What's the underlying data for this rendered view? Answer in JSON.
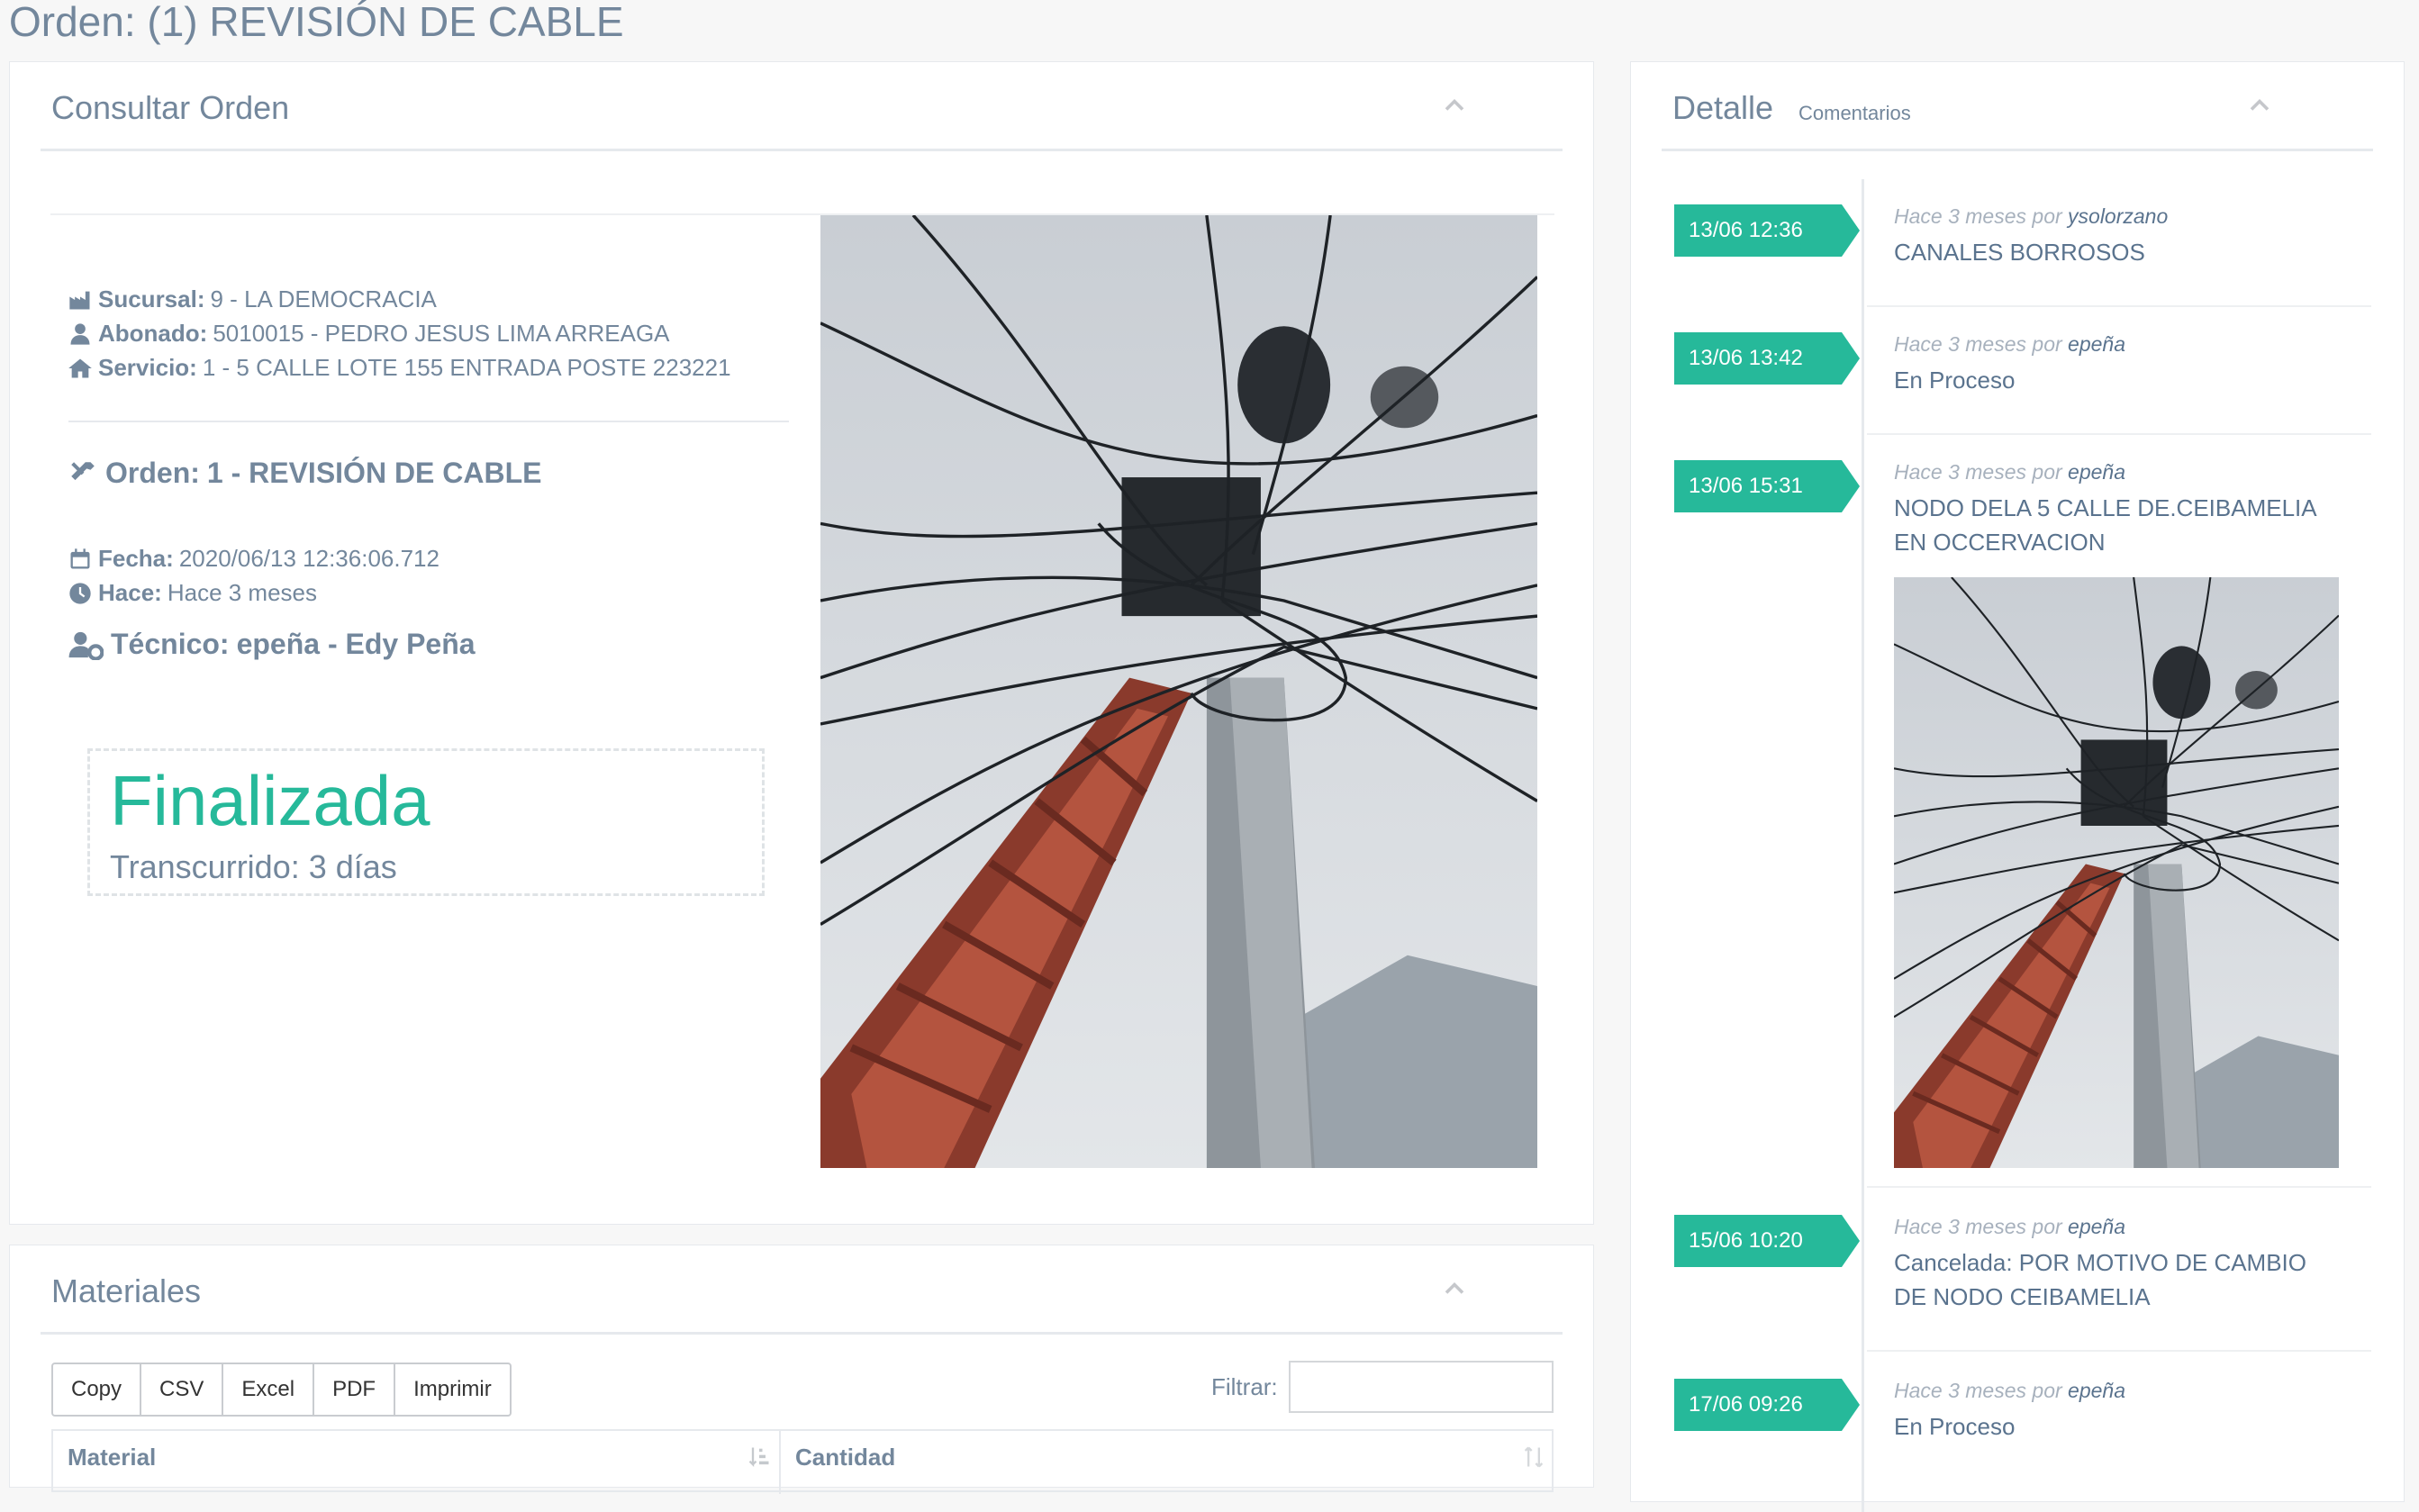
{
  "page": {
    "title": "Orden: (1) REVISIÓN DE CABLE"
  },
  "consultar": {
    "title": "Consultar Orden",
    "sucursal_label": "Sucursal:",
    "sucursal_value": "9 - LA DEMOCRACIA",
    "abonado_label": "Abonado:",
    "abonado_value": "5010015 - PEDRO JESUS LIMA ARREAGA",
    "servicio_label": "Servicio:",
    "servicio_value": "1 - 5 CALLE LOTE 155 ENTRADA POSTE 223221",
    "orden_label": "Orden:",
    "orden_value": "1 - REVISIÓN DE CABLE",
    "fecha_label": "Fecha:",
    "fecha_value": "2020/06/13 12:36:06.712",
    "hace_label": "Hace:",
    "hace_value": "Hace 3 meses",
    "tecnico_label": "Técnico:",
    "tecnico_value": "epeña - Edy Peña",
    "status": "Finalizada",
    "elapsed": "Transcurrido: 3 días"
  },
  "materiales": {
    "title": "Materiales",
    "buttons": [
      "Copy",
      "CSV",
      "Excel",
      "PDF",
      "Imprimir"
    ],
    "filter_label": "Filtrar:",
    "filter_value": "",
    "columns": [
      "Material",
      "Cantidad"
    ]
  },
  "detalle": {
    "title": "Detalle",
    "subtitle": "Comentarios",
    "meta_prefix": "Hace 3 meses por",
    "entries": [
      {
        "time": "13/06 12:36",
        "user": "ysolorzano",
        "text": "CANALES BORROSOS"
      },
      {
        "time": "13/06 13:42",
        "user": "epeña",
        "text": "En Proceso"
      },
      {
        "time": "13/06 15:31",
        "user": "epeña",
        "text": "NODO DELA 5 CALLE DE.CEIBAMELIA EN OCCERVACION"
      },
      {
        "time": "15/06 10:20",
        "user": "epeña",
        "text": "Cancelada: POR MOTIVO DE CAMBIO DE NODO CEIBAMELIA"
      },
      {
        "time": "17/06 09:26",
        "user": "epeña",
        "text": "En Proceso"
      }
    ]
  },
  "icons": {
    "collapse": "chevron-up-icon",
    "sucursal": "industry-icon",
    "abonado": "user-icon",
    "servicio": "home-icon",
    "orden": "tools-icon",
    "fecha": "calendar-icon",
    "hace": "clock-icon",
    "tecnico": "user-cog-icon",
    "sort": "sort-icon"
  },
  "colors": {
    "accent": "#26b99a",
    "text": "#73879c"
  }
}
